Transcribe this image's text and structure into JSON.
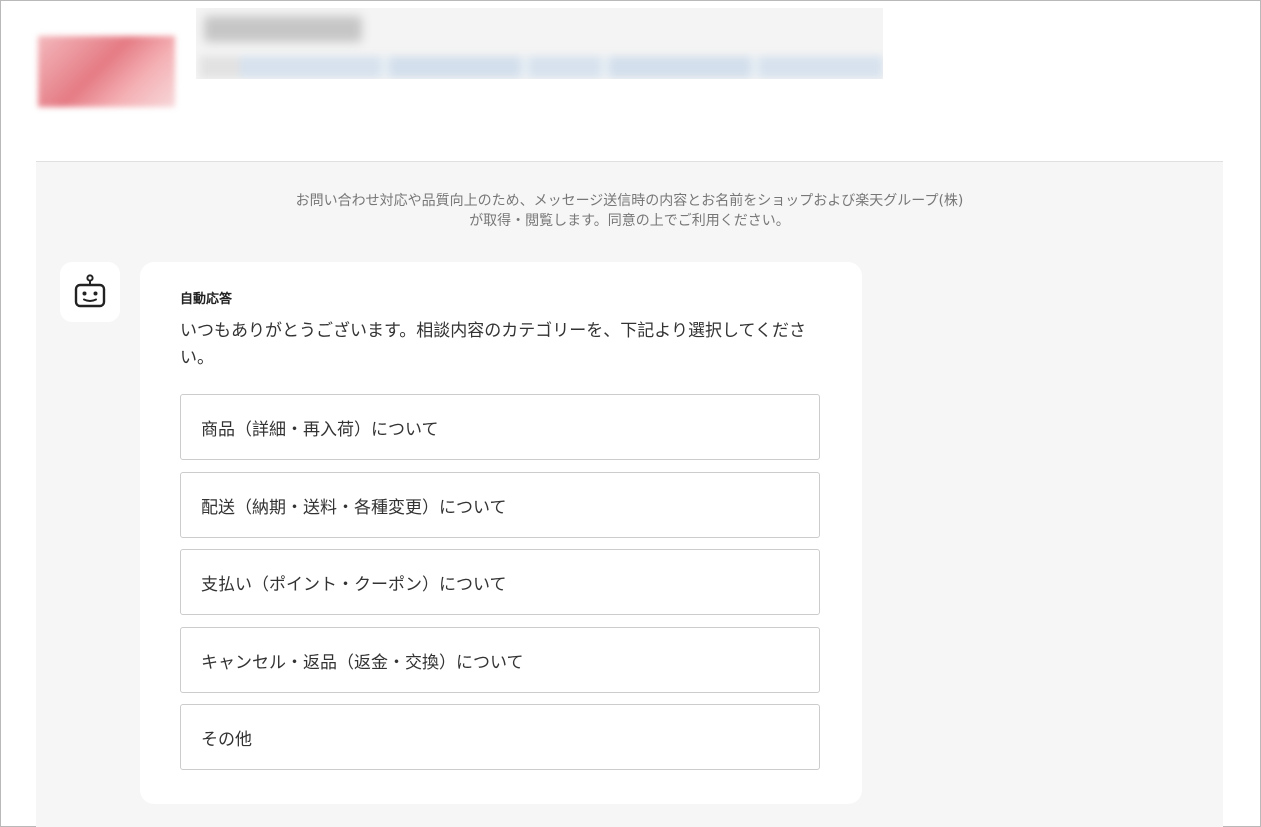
{
  "notice": {
    "line1": "お問い合わせ対応や品質向上のため、メッセージ送信時の内容とお名前をショップおよび楽天グループ(株)",
    "line2": "が取得・閲覧します。同意の上でご利用ください。"
  },
  "bot": {
    "icon": "robot-icon",
    "sender": "自動応答",
    "message": "いつもありがとうございます。相談内容のカテゴリーを、下記より選択してください。"
  },
  "options": [
    {
      "label": "商品（詳細・再入荷）について"
    },
    {
      "label": "配送（納期・送料・各種変更）について"
    },
    {
      "label": "支払い（ポイント・クーポン）について"
    },
    {
      "label": "キャンセル・返品（返金・交換）について"
    },
    {
      "label": "その他"
    }
  ],
  "colors": {
    "chat_background": "#f6f6f6",
    "bubble_background": "#ffffff",
    "option_border": "#cccccc",
    "notice_text": "#777777"
  }
}
